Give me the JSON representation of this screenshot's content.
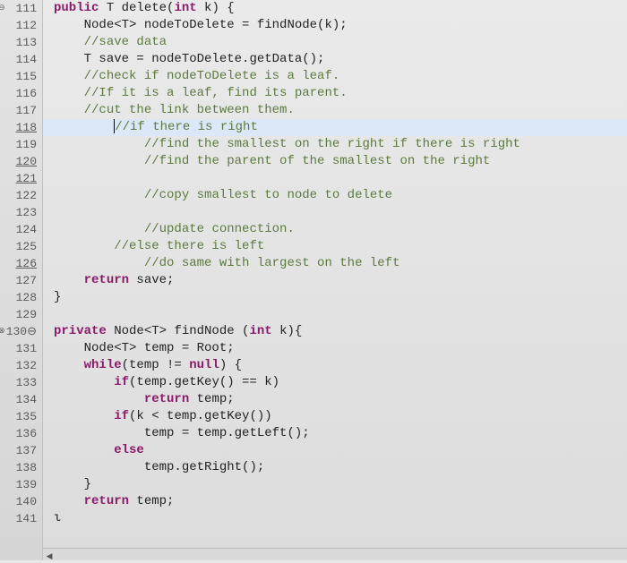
{
  "gutter": [
    {
      "num": "111",
      "anno": "⊖",
      "underline": false
    },
    {
      "num": "112",
      "underline": false
    },
    {
      "num": "113",
      "underline": false
    },
    {
      "num": "114",
      "underline": false
    },
    {
      "num": "115",
      "underline": false
    },
    {
      "num": "116",
      "underline": false
    },
    {
      "num": "117",
      "underline": false
    },
    {
      "num": "118",
      "underline": true
    },
    {
      "num": "119",
      "underline": false
    },
    {
      "num": "120",
      "underline": true
    },
    {
      "num": "121",
      "underline": true
    },
    {
      "num": "122",
      "underline": false
    },
    {
      "num": "123",
      "underline": false
    },
    {
      "num": "124",
      "underline": false
    },
    {
      "num": "125",
      "underline": false
    },
    {
      "num": "126",
      "underline": true
    },
    {
      "num": "127",
      "underline": false
    },
    {
      "num": "128",
      "underline": false
    },
    {
      "num": "129",
      "underline": false
    },
    {
      "num": "130",
      "anno": "⊗",
      "suffix": "⊖",
      "underline": false
    },
    {
      "num": "131",
      "underline": false
    },
    {
      "num": "132",
      "underline": false
    },
    {
      "num": "133",
      "underline": false
    },
    {
      "num": "134",
      "underline": false
    },
    {
      "num": "135",
      "underline": false
    },
    {
      "num": "136",
      "underline": false
    },
    {
      "num": "137",
      "underline": false
    },
    {
      "num": "138",
      "underline": false
    },
    {
      "num": "139",
      "underline": false
    },
    {
      "num": "140",
      "underline": false
    },
    {
      "num": "141",
      "underline": false
    }
  ],
  "code": {
    "l111": {
      "kw1": "public",
      "rest": " T delete(",
      "kw2": "int",
      "rest2": " k) {"
    },
    "l112": {
      "indent": "    ",
      "text": "Node<T> nodeToDelete = findNode(k);"
    },
    "l113": {
      "indent": "    ",
      "comment": "//save data"
    },
    "l114": {
      "indent": "    ",
      "text": "T save = nodeToDelete.getData();"
    },
    "l115": {
      "indent": "    ",
      "comment": "//check if nodeToDelete is a leaf."
    },
    "l116": {
      "indent": "    ",
      "comment": "//If it is a leaf, find its parent."
    },
    "l117": {
      "indent": "    ",
      "comment": "//cut the link between them."
    },
    "l118": {
      "indent": "        ",
      "comment": "//if there is right"
    },
    "l119": {
      "indent": "            ",
      "comment": "//find the smallest on the right if there is right"
    },
    "l120": {
      "indent": "            ",
      "comment": "//find the parent of the smallest on the right"
    },
    "l121": {
      "indent": "            ",
      "text": ""
    },
    "l122": {
      "indent": "            ",
      "comment": "//copy smallest to node to delete"
    },
    "l123": {
      "indent": "            ",
      "text": ""
    },
    "l124": {
      "indent": "            ",
      "comment": "//update connection."
    },
    "l125": {
      "indent": "        ",
      "comment": "//else there is left"
    },
    "l126": {
      "indent": "            ",
      "comment": "//do same with largest on the left"
    },
    "l127": {
      "indent": "    ",
      "kw": "return",
      "rest": " save;"
    },
    "l128": {
      "indent": "",
      "text": "}"
    },
    "l129": {
      "indent": "",
      "text": ""
    },
    "l130": {
      "kw1": "private",
      "rest": " Node<T> findNode (",
      "kw2": "int",
      "rest2": " k){"
    },
    "l131": {
      "indent": "    ",
      "text": "Node<T> temp = Root;"
    },
    "l132": {
      "indent": "    ",
      "kw": "while",
      "rest": "(temp != ",
      "kw2": "null",
      "rest2": ") {"
    },
    "l133": {
      "indent": "        ",
      "kw": "if",
      "rest": "(temp.getKey() == k)"
    },
    "l134": {
      "indent": "            ",
      "kw": "return",
      "rest": " temp;"
    },
    "l135": {
      "indent": "        ",
      "kw": "if",
      "rest": "(k < temp.getKey())"
    },
    "l136": {
      "indent": "            ",
      "text": "temp = temp.getLeft();"
    },
    "l137": {
      "indent": "        ",
      "kw": "else",
      "rest": ""
    },
    "l138": {
      "indent": "            ",
      "text": "temp.getRight();"
    },
    "l139": {
      "indent": "    ",
      "text": "}"
    },
    "l140": {
      "indent": "    ",
      "kw": "return",
      "rest": " temp;"
    },
    "l141": {
      "indent": "",
      "text": "ι"
    }
  }
}
